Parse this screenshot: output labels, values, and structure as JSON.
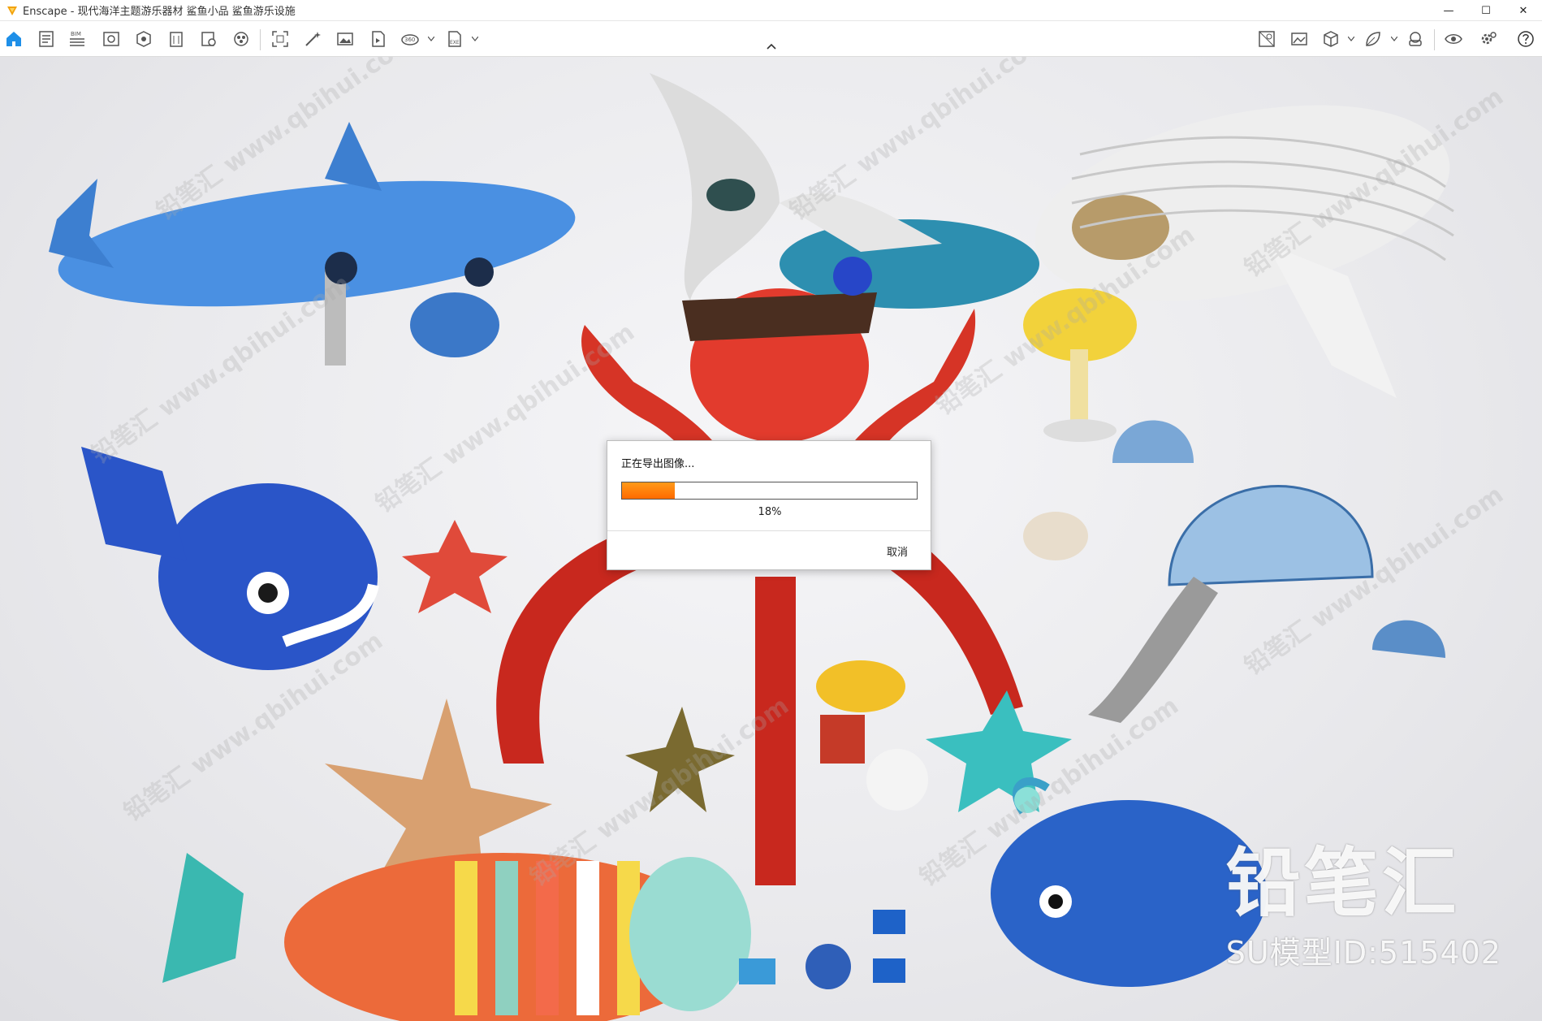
{
  "window": {
    "app_name": "Enscape",
    "title": "Enscape - 现代海洋主题游乐器材 鲨鱼小品 鲨鱼游乐设施",
    "controls": [
      "—",
      "☐",
      "✕"
    ]
  },
  "toolbar": {
    "items": [
      {
        "icon": "home-icon"
      },
      {
        "icon": "document-icon"
      },
      {
        "icon": "bim-icon",
        "label": "BIM"
      },
      {
        "icon": "view-mode-icon"
      },
      {
        "icon": "sun-icon"
      },
      {
        "icon": "building-icon"
      },
      {
        "icon": "settings-doc-icon"
      },
      {
        "icon": "material-icon"
      },
      {
        "icon": "capture-frame-icon"
      },
      {
        "icon": "magic-wand-icon"
      },
      {
        "icon": "image-icon"
      },
      {
        "icon": "video-icon"
      },
      {
        "icon": "panorama-icon",
        "label": "360"
      },
      {
        "icon": "export-exe-icon",
        "label": "EXE"
      },
      {
        "icon": "asset-library-icon"
      },
      {
        "icon": "gallery-icon"
      },
      {
        "icon": "cube-icon"
      },
      {
        "icon": "leaf-icon"
      },
      {
        "icon": "vr-headset-icon"
      },
      {
        "icon": "eye-icon"
      },
      {
        "icon": "gear-icon"
      },
      {
        "icon": "help-icon"
      }
    ]
  },
  "viewport": {
    "watermark_text": "铅笔汇 www.qbihui.com",
    "brand_name": "铅笔汇",
    "model_id": "SU模型ID:515402"
  },
  "dialog": {
    "title": "正在导出图像...",
    "progress_percent": 18,
    "progress_label": "18%",
    "cancel_label": "取消",
    "accent_color": "#ff7a00"
  }
}
